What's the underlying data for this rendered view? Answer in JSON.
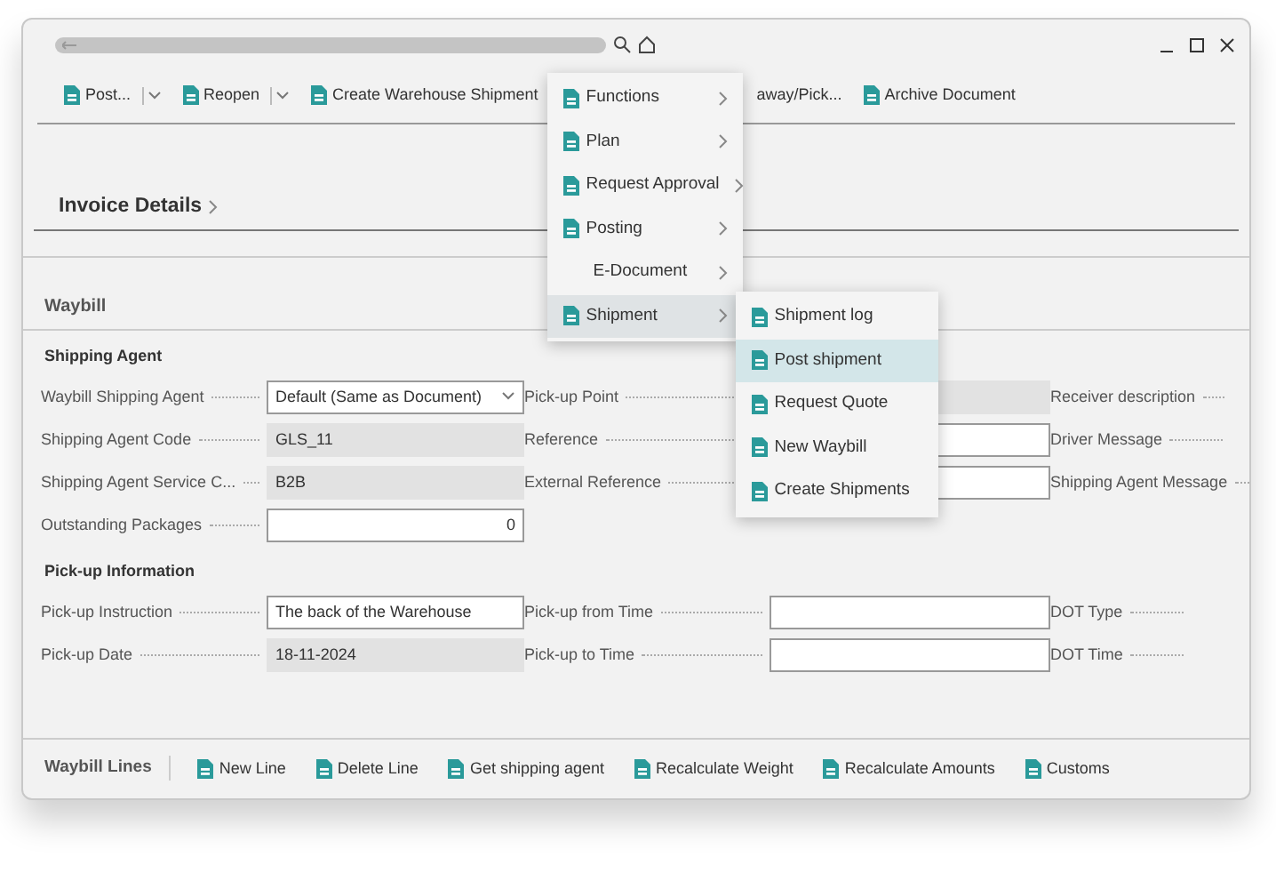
{
  "toolbar": [
    {
      "label": "Post...",
      "dropdown": true,
      "icon": true
    },
    {
      "label": "Reopen",
      "dropdown": true,
      "icon": true
    },
    {
      "label": "Create Warehouse Shipment",
      "dropdown": false,
      "icon": true
    },
    {
      "label": "away/Pick...",
      "dropdown": false,
      "icon": false
    },
    {
      "label": "Archive Document",
      "dropdown": false,
      "icon": true
    }
  ],
  "page_header": "Invoice Details",
  "section": "Waybill",
  "groups": [
    {
      "title": "Shipping Agent",
      "rows": [
        [
          {
            "label": "Waybill Shipping Agent",
            "kind": "dropdown",
            "value": "Default (Same as Document)"
          },
          {
            "label": "Pick-up Point",
            "kind": "readonly"
          },
          {
            "label": "Receiver description",
            "kind": "label"
          }
        ],
        [
          {
            "label": "Shipping Agent Code",
            "kind": "readonly",
            "value": "GLS_11"
          },
          {
            "label": "Reference",
            "kind": "input"
          },
          {
            "label": "Driver Message",
            "kind": "label"
          }
        ],
        [
          {
            "label": "Shipping Agent Service C...",
            "kind": "readonly",
            "value": "B2B"
          },
          {
            "label": "External Reference",
            "kind": "input"
          },
          {
            "label": "Shipping Agent Message",
            "kind": "label"
          }
        ],
        [
          {
            "label": "Outstanding Packages",
            "kind": "number",
            "value": "0"
          }
        ]
      ]
    },
    {
      "title": "Pick-up Information",
      "rows": [
        [
          {
            "label": "Pick-up Instruction",
            "kind": "input",
            "value": "The back of the Warehouse"
          },
          {
            "label": "Pick-up from Time",
            "kind": "input"
          },
          {
            "label": "DOT Type",
            "kind": "label"
          }
        ],
        [
          {
            "label": "Pick-up Date",
            "kind": "readonly",
            "value": "18-11-2024"
          },
          {
            "label": "Pick-up to Time",
            "kind": "input"
          },
          {
            "label": "DOT Time",
            "kind": "label"
          }
        ]
      ]
    }
  ],
  "menu": [
    {
      "label": "Functions",
      "icon": true,
      "selected": false
    },
    {
      "label": "Plan",
      "icon": true,
      "selected": false
    },
    {
      "label": "Request Approval",
      "icon": true,
      "selected": false
    },
    {
      "label": "Posting",
      "icon": true,
      "selected": false
    },
    {
      "label": "E-Document",
      "icon": false,
      "selected": false
    },
    {
      "label": "Shipment",
      "icon": true,
      "selected": true
    }
  ],
  "submenu": [
    {
      "label": "Shipment log",
      "selected": false
    },
    {
      "label": "Post shipment",
      "selected": true
    },
    {
      "label": "Request Quote",
      "selected": false
    },
    {
      "label": "New Waybill",
      "selected": false
    },
    {
      "label": "Create Shipments",
      "selected": false
    }
  ],
  "lines_bar": {
    "title": "Waybill Lines",
    "actions": [
      "New Line",
      "Delete Line",
      "Get shipping agent",
      "Recalculate Weight",
      "Recalculate Amounts",
      "Customs"
    ]
  }
}
